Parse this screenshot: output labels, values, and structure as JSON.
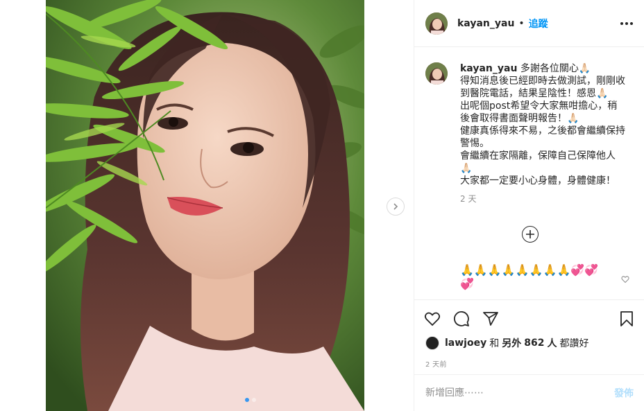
{
  "post": {
    "username": "kayan_yau",
    "separator": "•",
    "follow_label": "追蹤",
    "more_icon": "more-horizontal-icon"
  },
  "caption": {
    "username": "kayan_yau",
    "lines": [
      "多謝各位關心🙏🏻",
      "得知消息後已經即時去做測試，剛剛收到醫院電話，結果呈陰性！感恩🙏🏻",
      "出呢個post希望令大家無咁擔心，稍後會取得書面聲明報告！🙏🏻",
      "健康真係得來不易，之後都會繼續保持警惕。",
      "會繼續在家隔離，保障自己保障他人🙏🏻",
      "大家都一定要小心身體，身體健康！"
    ],
    "time": "2 天"
  },
  "comment": {
    "text": "🙏🙏🙏🙏🙏🙏🙏🙏💞💞💞"
  },
  "actions": {
    "like_icon": "heart-icon",
    "comment_icon": "comment-icon",
    "share_icon": "share-icon",
    "save_icon": "bookmark-icon"
  },
  "likes": {
    "first_user": "lawjoey",
    "and": "和",
    "others_prefix": "另外",
    "count": "862",
    "others_suffix": "人",
    "liked": "都讚好"
  },
  "post_time": "2 天前",
  "add_comment": {
    "placeholder": "新增回應⋯⋯",
    "post_label": "發佈"
  },
  "carousel": {
    "slide_count": 2,
    "active_index": 0
  },
  "colors": {
    "accent": "#0095f6",
    "carousel_dot": "#3897f0",
    "muted": "#8e8e8e",
    "post_disabled": "#b2dffc"
  }
}
